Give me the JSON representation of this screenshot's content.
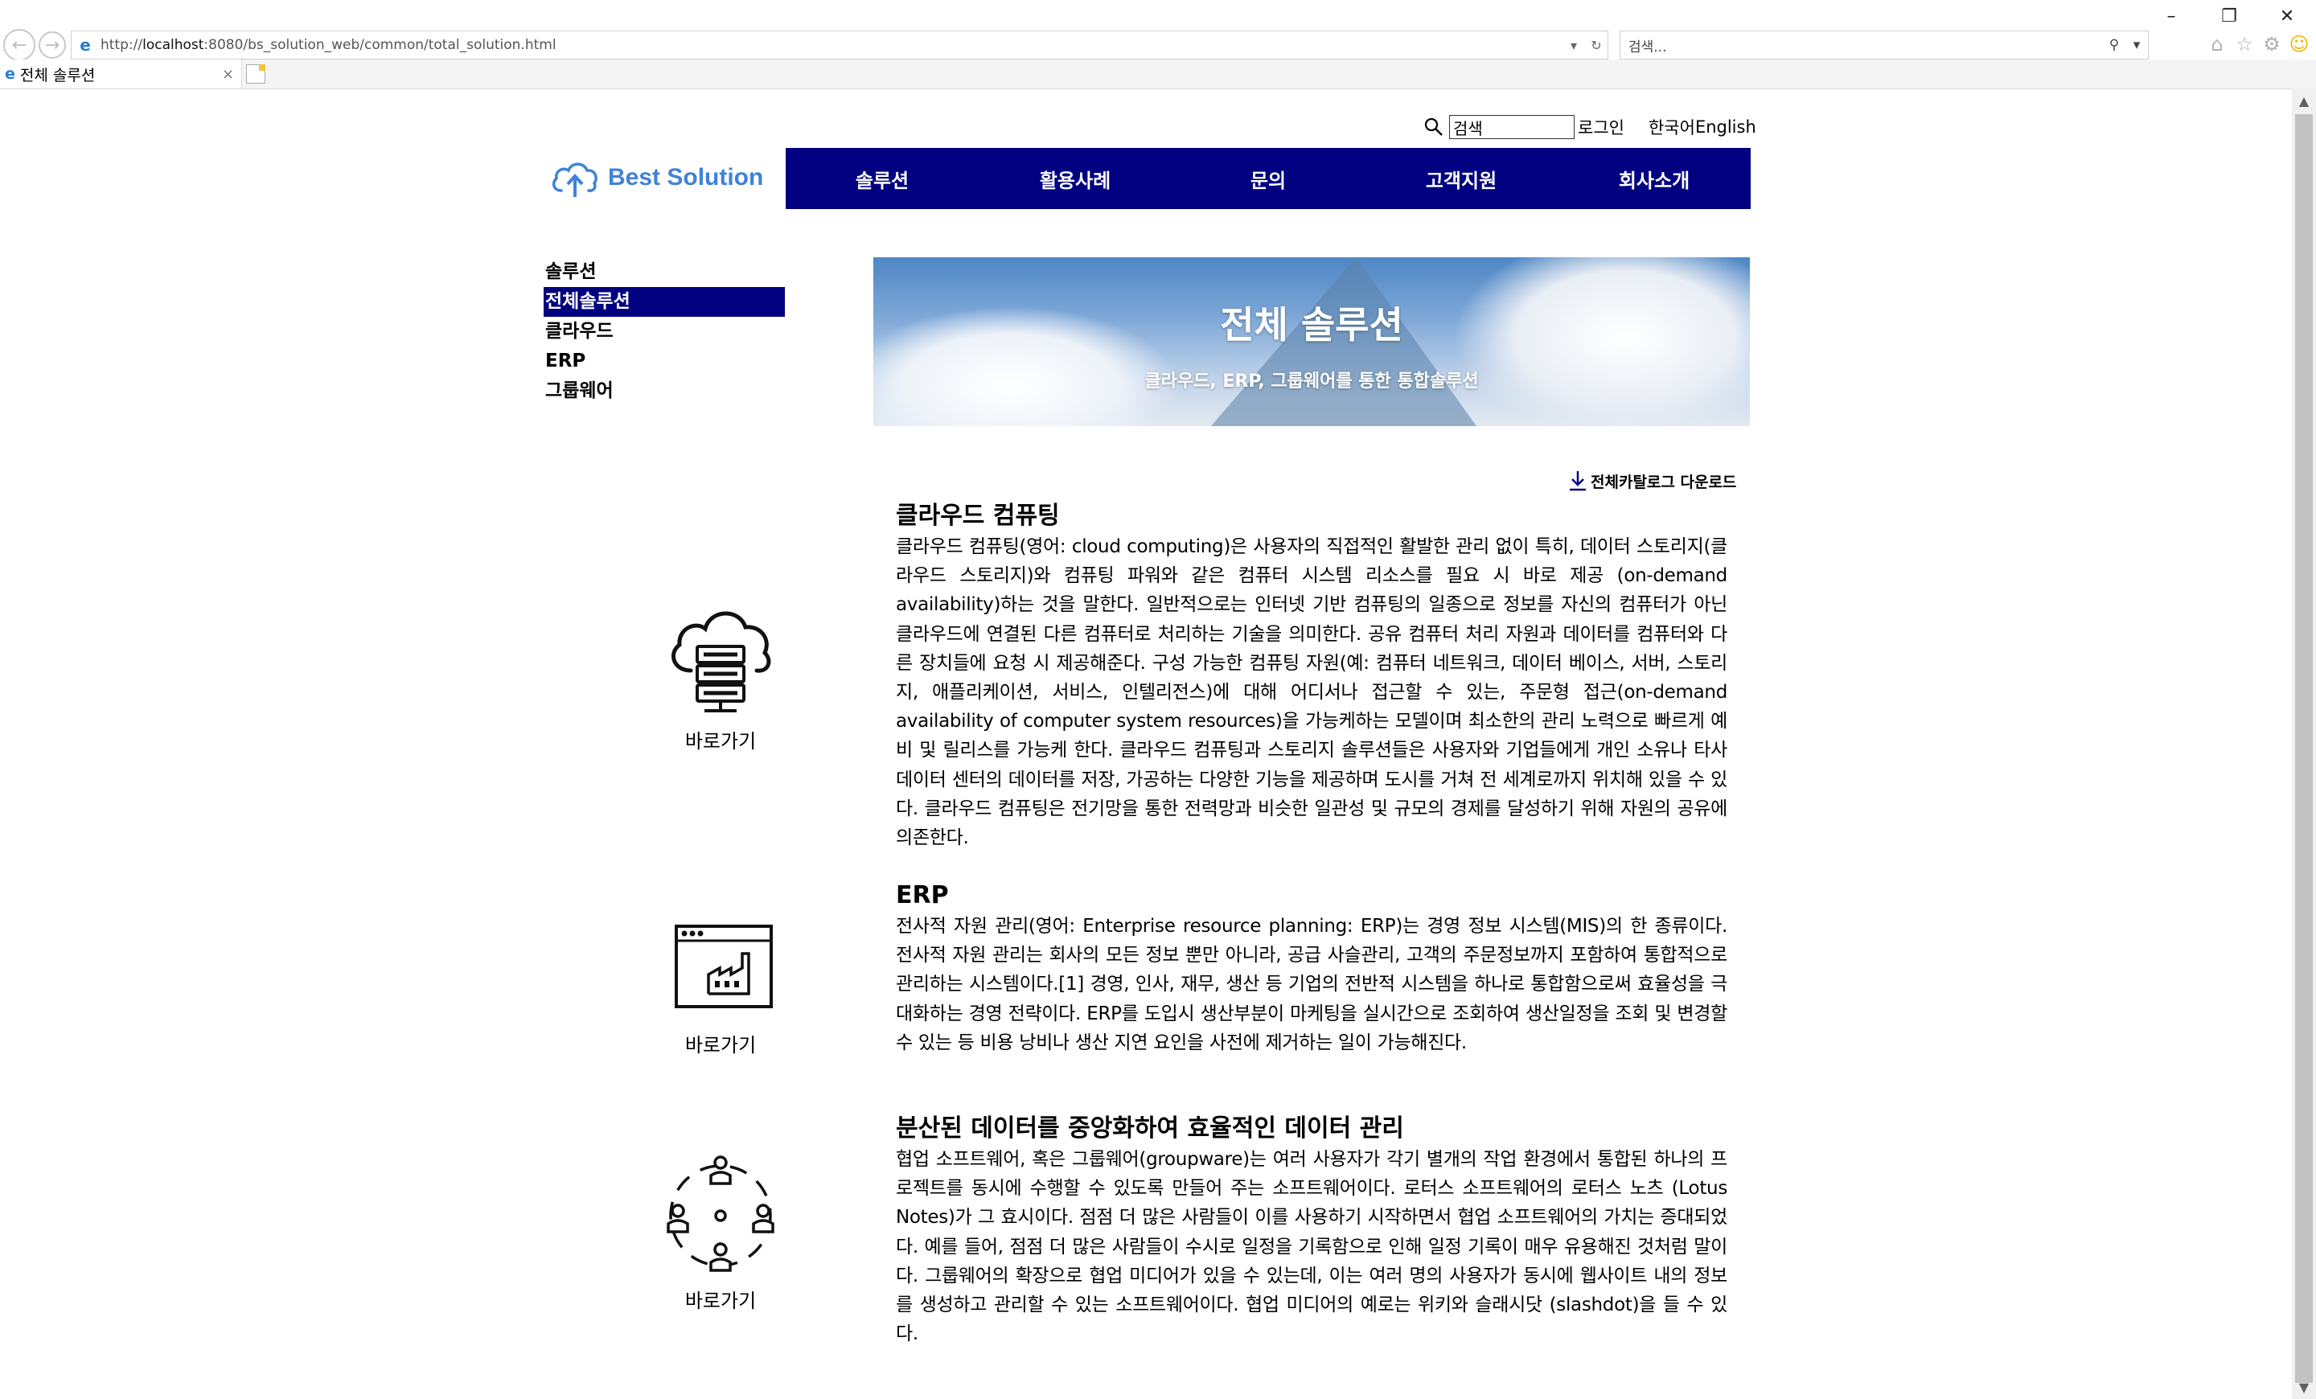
{
  "browser": {
    "url_prefix": "http://",
    "url_host": "localhost",
    "url_rest": ":8080/bs_solution_web/common/total_solution.html",
    "search_placeholder": "검색...",
    "tab_title": "전체 솔루션"
  },
  "header": {
    "search_value": "검색",
    "login": "로그인",
    "lang_ko": "한국어",
    "lang_en": "English",
    "logo_text": "Best Solution",
    "gnb": [
      "솔루션",
      "활용사례",
      "문의",
      "고객지원",
      "회사소개"
    ]
  },
  "lnb": {
    "title": "솔루션",
    "items": [
      "전체솔루션",
      "클라우드",
      "ERP",
      "그룹웨어"
    ]
  },
  "hero": {
    "title": "전체 솔루션",
    "subtitle": "클라우드, ERP, 그룹웨어를 통한 통합솔루션"
  },
  "catalog_download": "전체카탈로그 다운로드",
  "sections": [
    {
      "title": "클라우드 컴퓨팅",
      "link": "바로가기",
      "text": "클라우드 컴퓨팅(영어: cloud computing)은 사용자의 직접적인 활발한 관리 없이 특히, 데이터 스토리지(클라우드 스토리지)와 컴퓨팅 파워와 같은 컴퓨터 시스템 리소스를 필요 시 바로 제공 (on-demand availability)하는 것을 말한다. 일반적으로는 인터넷 기반 컴퓨팅의 일종으로 정보를 자신의 컴퓨터가 아닌 클라우드에 연결된 다른 컴퓨터로 처리하는 기술을 의미한다. 공유 컴퓨터 처리 자원과 데이터를 컴퓨터와 다른 장치들에 요청 시 제공해준다. 구성 가능한 컴퓨팅 자원(예: 컴퓨터 네트워크, 데이터 베이스, 서버, 스토리지, 애플리케이션, 서비스, 인텔리전스)에 대해 어디서나 접근할 수 있는, 주문형 접근(on-demand availability of computer system resources)을 가능케하는 모델이며 최소한의 관리 노력으로 빠르게 예비 및 릴리스를 가능케 한다. 클라우드 컴퓨팅과 스토리지 솔루션들은 사용자와 기업들에게 개인 소유나 타사 데이터 센터의 데이터를 저장, 가공하는 다양한 기능을 제공하며 도시를 거쳐 전 세계로까지 위치해 있을 수 있다. 클라우드 컴퓨팅은 전기망을 통한 전력망과 비슷한 일관성 및 규모의 경제를 달성하기 위해 자원의 공유에 의존한다."
    },
    {
      "title": "ERP",
      "link": "바로가기",
      "text": "전사적 자원 관리(영어: Enterprise resource planning: ERP)는 경영 정보 시스템(MIS)의 한 종류이다. 전사적 자원 관리는 회사의 모든 정보 뿐만 아니라, 공급 사슬관리, 고객의 주문정보까지 포함하여 통합적으로 관리하는 시스템이다.[1] 경영, 인사, 재무, 생산 등 기업의 전반적 시스템을 하나로 통합함으로써 효율성을 극대화하는 경영 전략이다. ERP를 도입시 생산부분이 마케팅을 실시간으로 조회하여 생산일정을 조회 및 변경할 수 있는 등 비용 낭비나 생산 지연 요인을 사전에 제거하는 일이 가능해진다."
    },
    {
      "title": "분산된 데이터를 중앙화하여 효율적인 데이터 관리",
      "link": "바로가기",
      "text": "협업 소프트웨어, 혹은 그룹웨어(groupware)는 여러 사용자가 각기 별개의 작업 환경에서 통합된 하나의 프로젝트를 동시에 수행할 수 있도록 만들어 주는 소프트웨어이다. 로터스 소프트웨어의 로터스 노츠 (Lotus Notes)가 그 효시이다. 점점 더 많은 사람들이 이를 사용하기 시작하면서 협업 소프트웨어의 가치는 증대되었다. 예를 들어, 점점 더 많은 사람들이 수시로 일정을 기록함으로 인해 일정 기록이 매우 유용해진 것처럼 말이다. 그룹웨어의 확장으로 협업 미디어가 있을 수 있는데, 이는 여러 명의 사용자가 동시에 웹사이트 내의 정보를 생성하고 관리할 수 있는 소프트웨어이다. 협업 미디어의 예로는 위키와 슬래시닷 (slashdot)을 들 수 있다."
    }
  ],
  "colors": {
    "nav_bg": "#000080",
    "logo_blue": "#3f82d8"
  }
}
